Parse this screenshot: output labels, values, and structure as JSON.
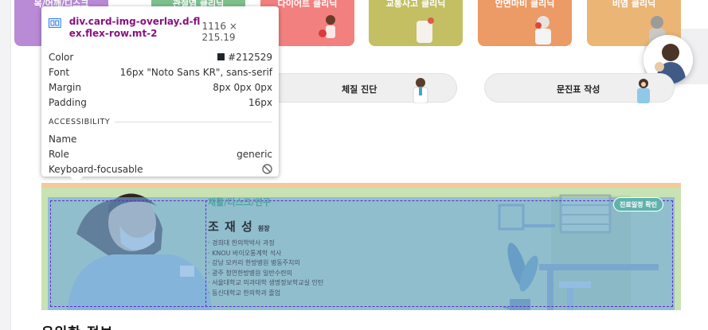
{
  "categories": [
    {
      "label": "목/어깨/디스크",
      "color": "#b98ad6"
    },
    {
      "label": "관절염 클리닉",
      "color": "#7cc08d"
    },
    {
      "label": "다이어트 클리닉",
      "color": "#f2807e"
    },
    {
      "label": "교통사고 클리닉",
      "color": "#c3bf62"
    },
    {
      "label": "안면마비 클리닉",
      "color": "#ec9a66"
    },
    {
      "label": "비염 클리닉",
      "color": "#ebb575"
    }
  ],
  "pills": [
    {
      "label": "체질 진단",
      "icon": "doctor-figure-icon"
    },
    {
      "label": "문진표 작성",
      "icon": "nurse-figure-icon"
    }
  ],
  "doctor": {
    "category": "재활/디스크/연구",
    "name": "조 재 성",
    "title": "원장",
    "badge": "진료일정 확인",
    "career": [
      "· 경희대 한의학박사 과정",
      "· KNOU 바이오통계학 석사",
      "· 강남 모커리 한방병원 병동주치의",
      "· 광주 청연한방병원 일반수련의",
      "· 서울대학교 의과대학 생명정보학교실 인턴",
      "· 동신대학교 한의학과 졸업"
    ]
  },
  "section_title": "유익한 정보",
  "tooltip": {
    "selector": "div.card-img-overlay.d-flex.flex-row.mt-2",
    "size": "1116 × 215.19",
    "rows": [
      {
        "key": "Color",
        "value": "#212529"
      },
      {
        "key": "Font",
        "value": "16px \"Noto Sans KR\", sans-serif"
      },
      {
        "key": "Margin",
        "value": "8px 0px 0px"
      },
      {
        "key": "Padding",
        "value": "16px"
      }
    ],
    "accessibility_label": "ACCESSIBILITY",
    "a11y_rows": [
      {
        "key": "Name",
        "value": ""
      },
      {
        "key": "Role",
        "value": "generic"
      },
      {
        "key": "Keyboard-focusable",
        "value": ""
      }
    ]
  }
}
